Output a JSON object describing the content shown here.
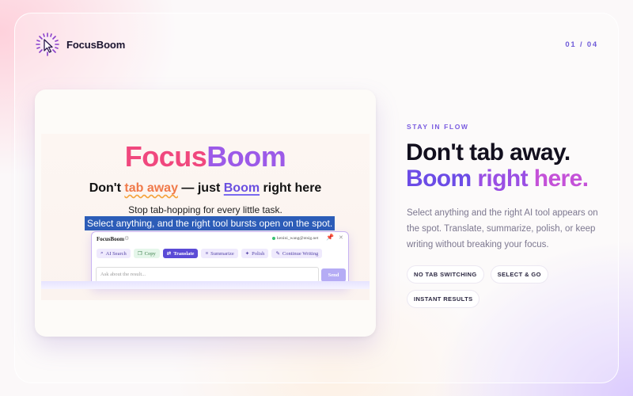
{
  "brand": {
    "name": "FocusBoom"
  },
  "pager": {
    "text": "01 / 04"
  },
  "card": {
    "logo_part1": "Focus",
    "logo_part2": "Boom",
    "tagline_pre": "Don't ",
    "tagline_u1": "tab away",
    "tagline_mid": " — just ",
    "tagline_u2": "Boom",
    "tagline_post": " right here",
    "sub1": "Stop tab-hopping for every little task.",
    "sub2_selected": "Select anything, and the right tool bursts open on the spot.",
    "popup": {
      "title": "FocusBoom",
      "user": "kenini_wang@ntsig.net",
      "tools": [
        {
          "label": "AI Search",
          "icon": "search-icon"
        },
        {
          "label": "Copy",
          "icon": "copy-icon"
        },
        {
          "label": "Translate",
          "icon": "translate-icon",
          "active": true
        },
        {
          "label": "Summarize",
          "icon": "list-icon"
        },
        {
          "label": "Polish",
          "icon": "wand-icon"
        },
        {
          "label": "Continue Writing",
          "icon": "pen-icon"
        }
      ],
      "ask_placeholder": "Ask about the result...",
      "send_label": "Send"
    }
  },
  "hero": {
    "eyebrow": "STAY IN FLOW",
    "line1": "Don't tab away.",
    "line2_a": "Boom ",
    "line2_b": "right ",
    "line2_c": "here.",
    "description": "Select anything and the right AI tool appears on the spot. Translate, summarize, polish, or keep writing without breaking your focus.",
    "chips": [
      "NO TAB SWITCHING",
      "SELECT & GO",
      "INSTANT RESULTS"
    ]
  },
  "colors": {
    "accent": "#7b4ae8",
    "pink": "#f0487e",
    "purple": "#9c5ae8"
  }
}
